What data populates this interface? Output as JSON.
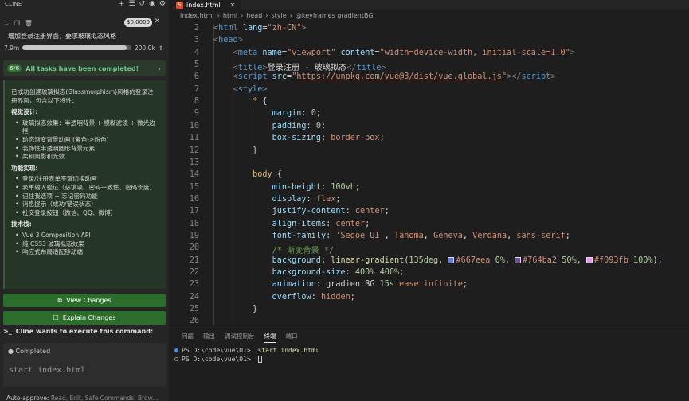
{
  "sidebar": {
    "title": "CLINE",
    "task": {
      "cost": "$0.0000",
      "text": "增加登录注册界面，要求玻璃拟态风格",
      "tokens_left": "7.9m",
      "tokens_right": "200.0k",
      "progress": 0.96
    },
    "completed": {
      "badge": "6/6",
      "text": "All tasks have been completed!"
    },
    "result": {
      "intro": "已成功创建玻璃拟态(Glassmorphism)风格的登录注册界面，包含以下特性：",
      "sections": [
        {
          "title": "视觉设计:",
          "items": [
            "玻璃拟态效果：半透明背景 + 模糊滤镜 + 微光边框",
            "动态渐变背景动画 (紫色->粉色)",
            "装饰性半透明圆形背景元素",
            "柔和阴影和光效"
          ]
        },
        {
          "title": "功能实现:",
          "items": [
            "登录/注册表单平滑切换动画",
            "表单输入验证（必填项、密码一致性、密码长度）",
            "记住我选项 + 忘记密码功能",
            "消息提示（成功/错误状态）",
            "社交登录按钮（微信、QQ、微博）"
          ]
        },
        {
          "title": "技术栈:",
          "items": [
            "Vue 3 Composition API",
            "纯 CSS3 玻璃拟态效果",
            "响应式布局适配移动端"
          ]
        }
      ]
    },
    "buttons": {
      "view": "View Changes",
      "explain": "Explain Changes"
    },
    "command": {
      "title": "Cline wants to execute this command:",
      "status": "Completed",
      "text": "start index.html"
    },
    "auto_approve": {
      "label": "Auto-approve:",
      "value": "Read, Edit, Safe Commands, Brow..."
    }
  },
  "editor": {
    "tab": "index.html",
    "breadcrumb": [
      "index.html",
      "html",
      "head",
      "style",
      "@keyframes gradientBG"
    ],
    "line_numbers": [
      2,
      3,
      4,
      5,
      6,
      7,
      8,
      9,
      10,
      11,
      12,
      13,
      14,
      15,
      16,
      17,
      18,
      19,
      20,
      21,
      22,
      23,
      24,
      25,
      26,
      27
    ],
    "colors": {
      "c1": "#667eea",
      "c2": "#764ba2",
      "c3": "#f093fb"
    }
  },
  "terminal": {
    "tabs": [
      "问题",
      "输出",
      "调试控制台",
      "终端",
      "端口"
    ],
    "active": 3,
    "lines": [
      {
        "prompt": "PS D:\\code\\vue\\01> ",
        "cmd": "start index.html"
      },
      {
        "prompt": "PS D:\\code\\vue\\01> ",
        "cmd": ""
      }
    ]
  }
}
